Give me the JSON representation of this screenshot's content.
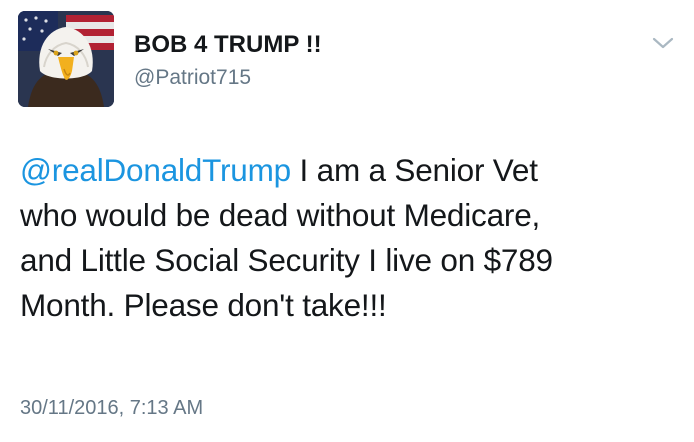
{
  "user": {
    "display_name": "BOB 4 TRUMP !!",
    "handle": "@Patriot715",
    "avatar_icon": "bald-eagle-flag-avatar"
  },
  "tweet": {
    "mention": "@realDonaldTrump",
    "line1_rest": " I am a Senior Vet",
    "line2": "who would be dead without Medicare,",
    "line3": "and Little Social Security I live on $789",
    "line4": "Month. Please don't take!!!",
    "timestamp": "30/11/2016, 7:13 AM"
  },
  "menu": {
    "icon": "chevron-down-icon"
  },
  "colors": {
    "link": "#1b95e0",
    "secondary_text": "#657786",
    "primary_text": "#14171a"
  }
}
